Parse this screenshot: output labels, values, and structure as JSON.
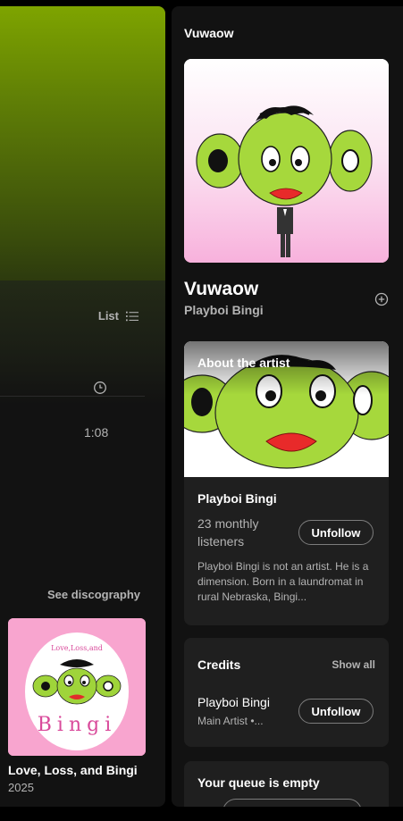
{
  "left": {
    "list_label": "List",
    "track_duration": "1:08",
    "see_discography": "See discography",
    "album": {
      "title": "Love, Loss, and Bingi",
      "year": "2025",
      "art_text_top": "Love,Loss,and",
      "art_text_bottom": "Bingi"
    }
  },
  "right": {
    "header": "Vuwaow",
    "song_title": "Vuwaow",
    "song_artist": "Playboi Bingi",
    "about": {
      "label": "About the artist",
      "name": "Playboi Bingi",
      "listeners": "23 monthly listeners",
      "unfollow": "Unfollow",
      "bio": "Playboi Bingi is not an artist. He is a dimension. Born in a laundromat in rural Nebraska, Bingi..."
    },
    "credits": {
      "title": "Credits",
      "show_all": "Show all",
      "name": "Playboi Bingi",
      "role": "Main Artist •...",
      "unfollow": "Unfollow"
    },
    "queue": {
      "title": "Your queue is empty"
    }
  },
  "colors": {
    "accent_green": "#7ea400",
    "pink": "#f8a5cf",
    "panel_bg": "#121212",
    "card_bg": "#1f1f1f",
    "muted_text": "#b3b3b3"
  }
}
